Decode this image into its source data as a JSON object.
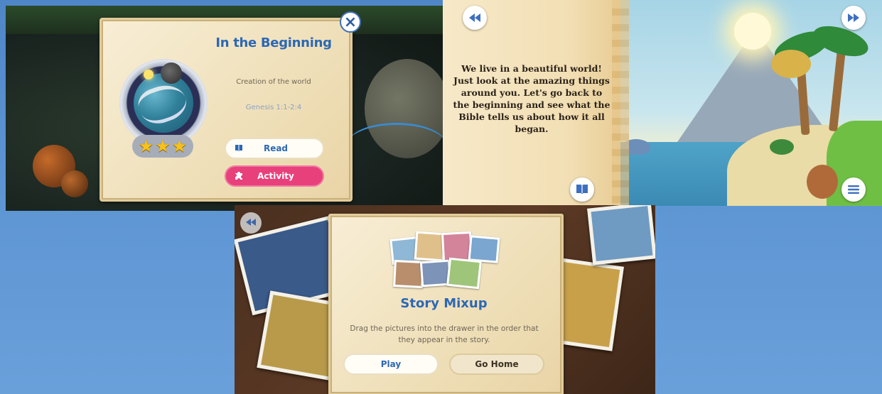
{
  "panel1": {
    "title": "In the Beginning",
    "subtitle": "Creation of the world",
    "scripture": "Genesis 1:1-2:4",
    "stars": [
      "★",
      "★",
      "★"
    ],
    "close_icon": "×",
    "read_label": "Read",
    "activity_label": "Activity",
    "read_icon": "book-icon",
    "activity_icon": "puzzle-icon"
  },
  "panel2": {
    "story_text": "We live in a beautiful world! Just look at the amazing things around you. Let's go back to the beginning and see what the Bible tells us about how it all began.",
    "prev_icon": "rewind-icon",
    "next_icon": "fast-forward-icon",
    "book_icon": "book-icon",
    "menu_icon": "menu-icon"
  },
  "panel3": {
    "title": "Story Mixup",
    "description": "Drag the pictures into the drawer in the order that they appear in the story.",
    "play_label": "Play",
    "gohome_label": "Go Home",
    "prev_icon": "rewind-icon"
  },
  "colors": {
    "title_blue": "#2c68b4",
    "activity_pink": "#e8407a",
    "background_blue": "#5b93d2"
  }
}
